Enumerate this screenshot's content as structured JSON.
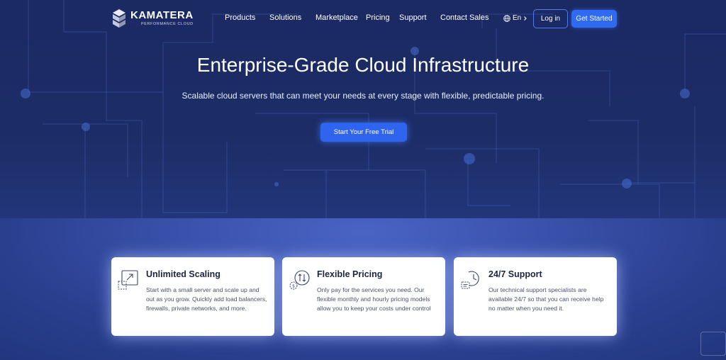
{
  "header": {
    "logo_name": "KAMATERA",
    "logo_sub": "PERFORMANCE CLOUD",
    "nav": [
      "Products",
      "Solutions",
      "Marketplace",
      "Pricing",
      "Support",
      "Contact Sales"
    ],
    "language": "En",
    "login_label": "Log in",
    "get_started_label": "Get Started"
  },
  "hero": {
    "title": "Enterprise-Grade Cloud Infrastructure",
    "subtitle": "Scalable cloud servers that can meet your needs at every stage with flexible, predictable pricing.",
    "cta_label": "Start Your Free Trial"
  },
  "features": [
    {
      "title": "Unlimited Scaling",
      "description": "Start with a small server and scale up and out as you grow. Quickly add load balancers, firewalls, private networks, and more.",
      "icon": "scale-arrow-icon"
    },
    {
      "title": "Flexible Pricing",
      "description": "Only pay for the services you need. Our flexible monthly and hourly pricing models allow you to keep your costs under control",
      "icon": "pricing-arrows-icon"
    },
    {
      "title": "24/7 Support",
      "description": "Our technical support specialists are available 24/7 so that you can receive help no matter when you need it.",
      "icon": "support-clock-icon"
    }
  ],
  "colors": {
    "hero_bg": "#1b2a63",
    "accent": "#2f6bf2",
    "card_bg": "#ffffff",
    "card_title": "#1d2640"
  }
}
